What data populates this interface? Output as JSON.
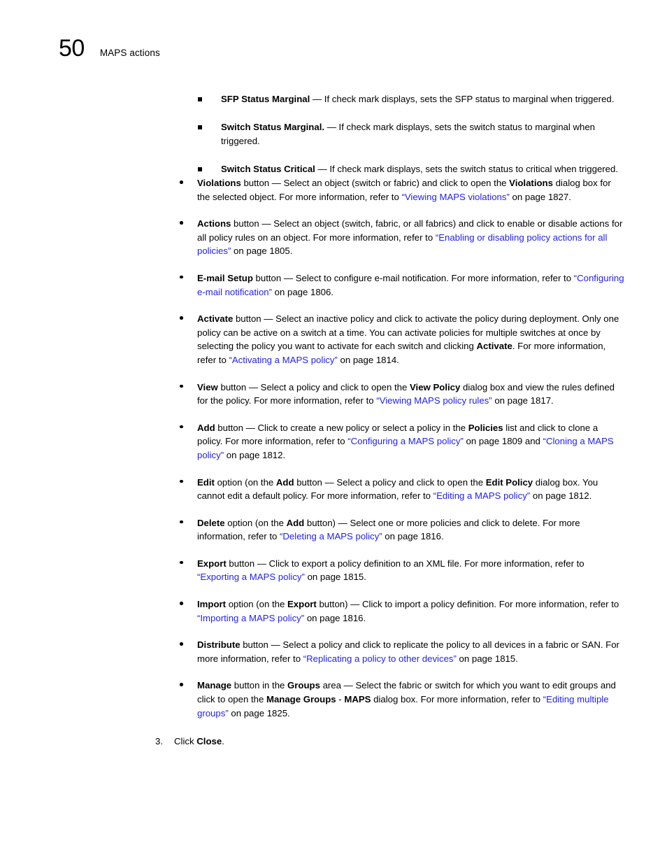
{
  "header": {
    "folio": "50",
    "title": "MAPS actions"
  },
  "sub_bullets": [
    {
      "term": "SFP Status Marginal",
      "body": " — If check mark displays, sets the SFP status to marginal when triggered."
    },
    {
      "term": "Switch Status Marginal.",
      "body": " — If check mark displays, sets the switch status to marginal when triggered."
    },
    {
      "term": "Switch Status Critical",
      "body": " — If check mark displays, sets the switch status to critical when triggered."
    }
  ],
  "main_bullets": [
    {
      "id": "violations",
      "segments": [
        {
          "t": "Violations",
          "s": "bold"
        },
        {
          "t": " button — Select an object (switch or fabric) and click to open the ",
          "s": "plain"
        },
        {
          "t": "Violations",
          "s": "bold"
        },
        {
          "t": " dialog box for the selected object. For more information, refer to ",
          "s": "plain"
        },
        {
          "t": "“Viewing MAPS violations”",
          "s": "link"
        },
        {
          "t": " on page 1827.",
          "s": "plain"
        }
      ]
    },
    {
      "id": "actions",
      "segments": [
        {
          "t": "Actions",
          "s": "bold"
        },
        {
          "t": " button — Select an object (switch, fabric, or all fabrics) and click to enable or disable actions for all policy rules on an object. For more information, refer to ",
          "s": "plain"
        },
        {
          "t": "“Enabling or disabling policy actions for all policies”",
          "s": "link"
        },
        {
          "t": " on page 1805.",
          "s": "plain"
        }
      ]
    },
    {
      "id": "email-setup",
      "segments": [
        {
          "t": "E-mail Setup",
          "s": "bold"
        },
        {
          "t": " button — Select to configure e-mail notification. For more information, refer to ",
          "s": "plain"
        },
        {
          "t": "“Configuring e-mail notification”",
          "s": "link"
        },
        {
          "t": " on page 1806.",
          "s": "plain"
        }
      ]
    },
    {
      "id": "activate",
      "segments": [
        {
          "t": "Activate",
          "s": "bold"
        },
        {
          "t": " button — Select an inactive policy and click to activate the policy during deployment. Only one policy can be active on a switch at a time. You can activate policies for multiple switches at once by selecting the policy you want to activate for each switch and clicking ",
          "s": "plain"
        },
        {
          "t": "Activate",
          "s": "bold"
        },
        {
          "t": ". For more information, refer to ",
          "s": "plain"
        },
        {
          "t": "“Activating a MAPS policy”",
          "s": "link"
        },
        {
          "t": " on page 1814.",
          "s": "plain"
        }
      ]
    },
    {
      "id": "view",
      "segments": [
        {
          "t": "View",
          "s": "bold"
        },
        {
          "t": " button — Select a policy and click to open the ",
          "s": "plain"
        },
        {
          "t": "View Policy",
          "s": "bold"
        },
        {
          "t": " dialog box and view the rules defined for the policy. For more information, refer to ",
          "s": "plain"
        },
        {
          "t": "“Viewing MAPS policy rules”",
          "s": "link"
        },
        {
          "t": " on page 1817.",
          "s": "plain"
        }
      ]
    },
    {
      "id": "add",
      "segments": [
        {
          "t": "Add",
          "s": "bold"
        },
        {
          "t": " button — Click to create a new policy or select a policy in the ",
          "s": "plain"
        },
        {
          "t": "Policies",
          "s": "bold"
        },
        {
          "t": " list and click to clone a policy. For more information, refer to ",
          "s": "plain"
        },
        {
          "t": "“Configuring a MAPS policy”",
          "s": "link"
        },
        {
          "t": " on page 1809 and ",
          "s": "plain"
        },
        {
          "t": "“Cloning a MAPS policy”",
          "s": "link"
        },
        {
          "t": " on page 1812.",
          "s": "plain"
        }
      ]
    },
    {
      "id": "edit",
      "segments": [
        {
          "t": "Edit",
          "s": "bold"
        },
        {
          "t": " option (on the ",
          "s": "plain"
        },
        {
          "t": "Add",
          "s": "bold"
        },
        {
          "t": " button — Select a policy and click to open the ",
          "s": "plain"
        },
        {
          "t": "Edit Policy",
          "s": "bold"
        },
        {
          "t": " dialog box. You cannot edit a default policy. For more information, refer to ",
          "s": "plain"
        },
        {
          "t": "“Editing a MAPS policy”",
          "s": "link"
        },
        {
          "t": " on page 1812.",
          "s": "plain"
        }
      ]
    },
    {
      "id": "delete",
      "segments": [
        {
          "t": "Delete",
          "s": "bold"
        },
        {
          "t": " option (on the ",
          "s": "plain"
        },
        {
          "t": "Add",
          "s": "bold"
        },
        {
          "t": " button) — Select one or more policies and click to delete. For more information, refer to ",
          "s": "plain"
        },
        {
          "t": "“Deleting a MAPS policy”",
          "s": "link"
        },
        {
          "t": " on page 1816.",
          "s": "plain"
        }
      ]
    },
    {
      "id": "export",
      "segments": [
        {
          "t": "Export",
          "s": "bold"
        },
        {
          "t": " button — Click to export a policy definition to an XML file. For more information, refer to ",
          "s": "plain"
        },
        {
          "t": "“Exporting a MAPS policy”",
          "s": "link"
        },
        {
          "t": " on page 1815.",
          "s": "plain"
        }
      ]
    },
    {
      "id": "import",
      "segments": [
        {
          "t": "Import",
          "s": "bold"
        },
        {
          "t": " option (on the ",
          "s": "plain"
        },
        {
          "t": "Export",
          "s": "bold"
        },
        {
          "t": " button) — Click to import a policy definition. For more information, refer to ",
          "s": "plain"
        },
        {
          "t": "“Importing a MAPS policy”",
          "s": "link"
        },
        {
          "t": " on page 1816.",
          "s": "plain"
        }
      ]
    },
    {
      "id": "distribute",
      "segments": [
        {
          "t": "Distribute",
          "s": "bold"
        },
        {
          "t": " button — Select a policy and click to replicate the policy to all devices in a fabric or SAN. For more information, refer to ",
          "s": "plain"
        },
        {
          "t": "“Replicating a policy to other devices”",
          "s": "link"
        },
        {
          "t": " on page 1815.",
          "s": "plain"
        }
      ]
    },
    {
      "id": "manage",
      "segments": [
        {
          "t": "Manage",
          "s": "bold"
        },
        {
          "t": " button in the ",
          "s": "plain"
        },
        {
          "t": "Groups",
          "s": "bold"
        },
        {
          "t": " area — Select the fabric or switch for which you want to edit groups and click to open the ",
          "s": "plain"
        },
        {
          "t": "Manage Groups",
          "s": "bold"
        },
        {
          "t": " - ",
          "s": "plain"
        },
        {
          "t": "MAPS",
          "s": "bold"
        },
        {
          "t": " dialog box. For more information, refer to ",
          "s": "plain"
        },
        {
          "t": "“Editing multiple groups”",
          "s": "link"
        },
        {
          "t": " on page 1825.",
          "s": "plain"
        }
      ]
    }
  ],
  "step": {
    "number": "3.",
    "segments": [
      {
        "t": "Click ",
        "s": "plain"
      },
      {
        "t": "Close",
        "s": "bold"
      },
      {
        "t": ".",
        "s": "plain"
      }
    ]
  },
  "colors": {
    "link": "#2222ee",
    "text": "#000000",
    "background": "#ffffff"
  }
}
